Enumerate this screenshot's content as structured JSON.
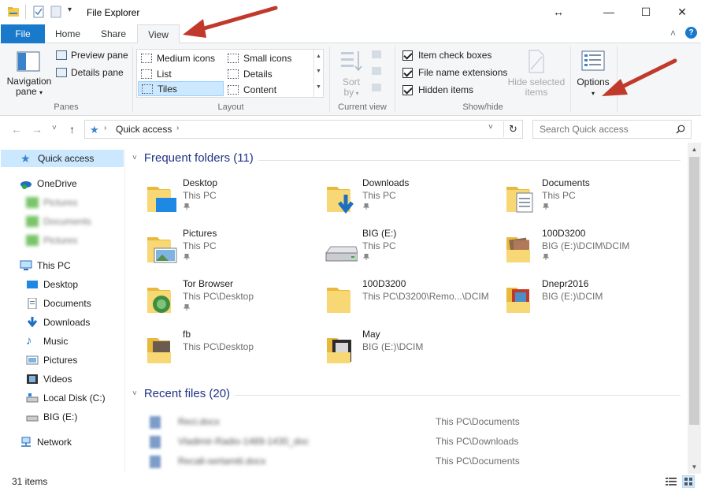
{
  "window": {
    "title": "File Explorer",
    "minimize_glyph": "—",
    "maximize_glyph": "☐",
    "close_glyph": "✕",
    "expand_glyph": "↔"
  },
  "ribbon": {
    "tabs": [
      "File",
      "Home",
      "Share",
      "View"
    ],
    "active_tab": "View",
    "collapse_glyph": "˄",
    "help_glyph": "?",
    "panes": {
      "navigation_pane": "Navigation pane",
      "navigation_pane_line1": "Navigation",
      "navigation_pane_line2": "pane",
      "preview_pane": "Preview pane",
      "details_pane": "Details pane",
      "label": "Panes"
    },
    "layout": {
      "items": [
        "Medium icons",
        "Small icons",
        "List",
        "Details",
        "Tiles",
        "Content"
      ],
      "selected": "Tiles",
      "label": "Layout"
    },
    "current_view": {
      "sort_by_line1": "Sort",
      "sort_by_line2": "by",
      "label": "Current view"
    },
    "show_hide": {
      "item_check_boxes": "Item check boxes",
      "file_name_extensions": "File name extensions",
      "hidden_items": "Hidden items",
      "hide_selected_line1": "Hide selected",
      "hide_selected_line2": "items",
      "label": "Show/hide"
    },
    "options": {
      "label": "Options"
    }
  },
  "address": {
    "back_glyph": "←",
    "forward_glyph": "→",
    "recent_glyph": "˅",
    "up_glyph": "↑",
    "path": "Quick access",
    "search_placeholder": "Search Quick access"
  },
  "nav": {
    "quick_access": "Quick access",
    "onedrive": "OneDrive",
    "onedrive_children": [
      "Pictures",
      "Documents",
      "Pictures"
    ],
    "this_pc": "This PC",
    "pc_children": [
      "Desktop",
      "Documents",
      "Downloads",
      "Music",
      "Pictures",
      "Videos",
      "Local Disk (C:)",
      "BIG (E:)"
    ],
    "network": "Network"
  },
  "frequent": {
    "header": "Frequent folders (11)",
    "items": [
      {
        "name": "Desktop",
        "path": "This PC"
      },
      {
        "name": "Downloads",
        "path": "This PC"
      },
      {
        "name": "Documents",
        "path": "This PC"
      },
      {
        "name": "Pictures",
        "path": "This PC"
      },
      {
        "name": "BIG (E:)",
        "path": "This PC"
      },
      {
        "name": "100D3200",
        "path": "BIG (E:)\\DCIM\\DCIM"
      },
      {
        "name": "Tor Browser",
        "path": "This PC\\Desktop"
      },
      {
        "name": "100D3200",
        "path": "This PC\\D3200\\Remo...\\DCIM"
      },
      {
        "name": "Dnepr2016",
        "path": "BIG (E:)\\DCIM"
      },
      {
        "name": "fb",
        "path": "This PC\\Desktop"
      },
      {
        "name": "May",
        "path": "BIG (E:)\\DCIM"
      }
    ]
  },
  "recent": {
    "header": "Recent files (20)",
    "items": [
      {
        "name": "Reci.docx",
        "location": "This PC\\Documents"
      },
      {
        "name": "Vladimir-Radio-1489-1430_doc",
        "location": "This PC\\Downloads"
      },
      {
        "name": "Recall-sertamiti.docx",
        "location": "This PC\\Documents"
      }
    ]
  },
  "status": {
    "count": "31 items"
  },
  "colors": {
    "accent": "#1979ca",
    "folder": "#f5c94e",
    "selection": "#cce8ff",
    "arrow": "#c0392b"
  }
}
